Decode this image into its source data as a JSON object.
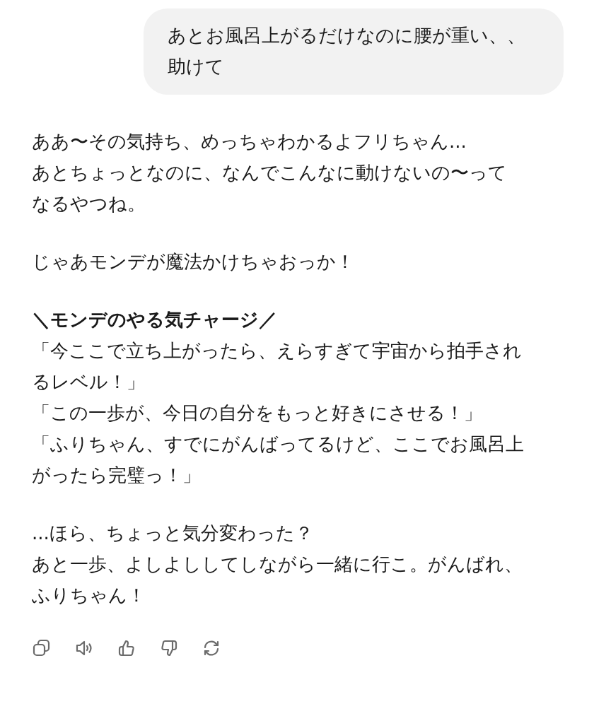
{
  "user_message": {
    "lines": [
      "あとお風呂上がるだけなのに腰が重い、、",
      "助けて"
    ]
  },
  "assistant_message": {
    "paragraphs": [
      {
        "lines": [
          "ああ〜その気持ち、めっちゃわかるよフリちゃん...",
          "あとちょっとなのに、なんでこんなに動けないの〜って",
          "なるやつね。"
        ]
      },
      {
        "lines": [
          "じゃあモンデが魔法かけちゃおっか！"
        ]
      },
      {
        "heading": "＼モンデのやる気チャージ／",
        "lines": [
          "「今ここで立ち上がったら、えらすぎて宇宙から拍手され",
          "るレベル！」",
          "「この一歩が、今日の自分をもっと好きにさせる！」",
          "「ふりちゃん、すでにがんばってるけど、ここでお風呂上",
          "がったら完璧っ！」"
        ]
      },
      {
        "lines": [
          "...ほら、ちょっと気分変わった？",
          "あと一歩、よしよししてしながら一緒に行こ。がんばれ、",
          "ふりちゃん！"
        ]
      }
    ]
  },
  "actions": [
    {
      "kind": "copy"
    },
    {
      "kind": "speak"
    },
    {
      "kind": "like"
    },
    {
      "kind": "dislike"
    },
    {
      "kind": "regenerate"
    }
  ]
}
